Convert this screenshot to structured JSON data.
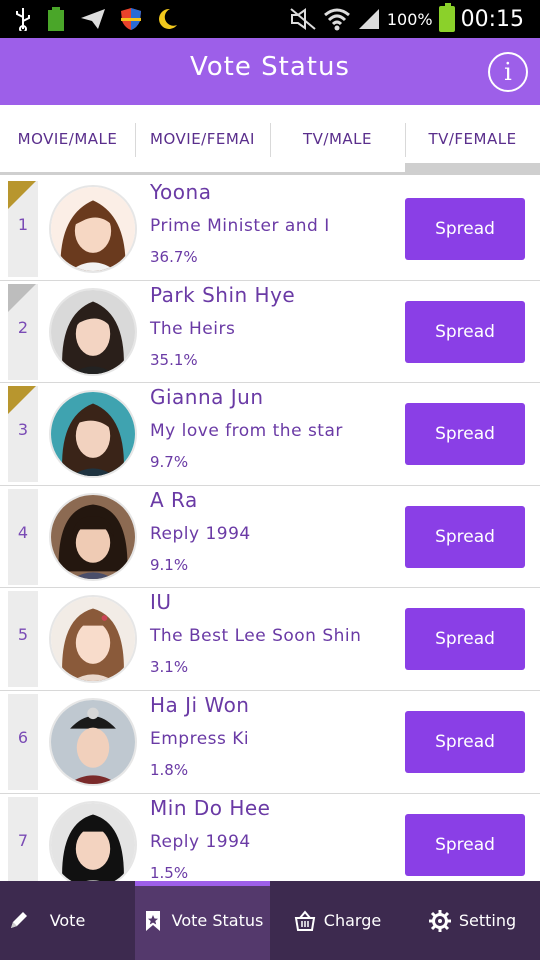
{
  "status_bar": {
    "battery_percent": "100%",
    "time": "00:15",
    "icons": [
      "usb-icon",
      "battery-small-icon",
      "send-icon",
      "shield-icon",
      "moon-icon",
      "mute-icon",
      "wifi-icon",
      "signal-icon",
      "battery-icon"
    ]
  },
  "header": {
    "title": "Vote Status",
    "info_label": "i"
  },
  "tabs": [
    {
      "label": "MOVIE/MALE",
      "active": false
    },
    {
      "label": "MOVIE/FEMAI",
      "active": false
    },
    {
      "label": "TV/MALE",
      "active": false
    },
    {
      "label": "TV/FEMALE",
      "active": true
    }
  ],
  "ranking": [
    {
      "rank": "1",
      "name": "Yoona",
      "show": "Prime Minister and I",
      "percent": "36.7%",
      "ribbon": "gold",
      "button": "Spread"
    },
    {
      "rank": "2",
      "name": "Park Shin Hye",
      "show": "The Heirs",
      "percent": "35.1%",
      "ribbon": "silver",
      "button": "Spread"
    },
    {
      "rank": "3",
      "name": "Gianna Jun",
      "show": "My love from the star",
      "percent": "9.7%",
      "ribbon": "bronze",
      "button": "Spread"
    },
    {
      "rank": "4",
      "name": "A Ra",
      "show": "Reply 1994",
      "percent": "9.1%",
      "ribbon": "",
      "button": "Spread"
    },
    {
      "rank": "5",
      "name": "IU",
      "show": "The Best Lee Soon Shin",
      "percent": "3.1%",
      "ribbon": "",
      "button": "Spread"
    },
    {
      "rank": "6",
      "name": "Ha Ji Won",
      "show": "Empress Ki",
      "percent": "1.8%",
      "ribbon": "",
      "button": "Spread"
    },
    {
      "rank": "7",
      "name": "Min Do Hee",
      "show": "Reply 1994",
      "percent": "1.5%",
      "ribbon": "",
      "button": "Spread"
    }
  ],
  "bottom_nav": [
    {
      "label": "Vote",
      "icon": "pencil-icon",
      "active": false
    },
    {
      "label": "Vote Status",
      "icon": "bookmark-star-icon",
      "active": true
    },
    {
      "label": "Charge",
      "icon": "basket-icon",
      "active": false
    },
    {
      "label": "Setting",
      "icon": "gear-icon",
      "active": false
    }
  ],
  "colors": {
    "accent": "#9d5fe9",
    "button": "#8a3fe6",
    "text": "#6a3aa5",
    "nav_bg": "#3d2a4f",
    "gold_ribbon": "#b8962e",
    "silver_ribbon": "#bdbdbd"
  }
}
